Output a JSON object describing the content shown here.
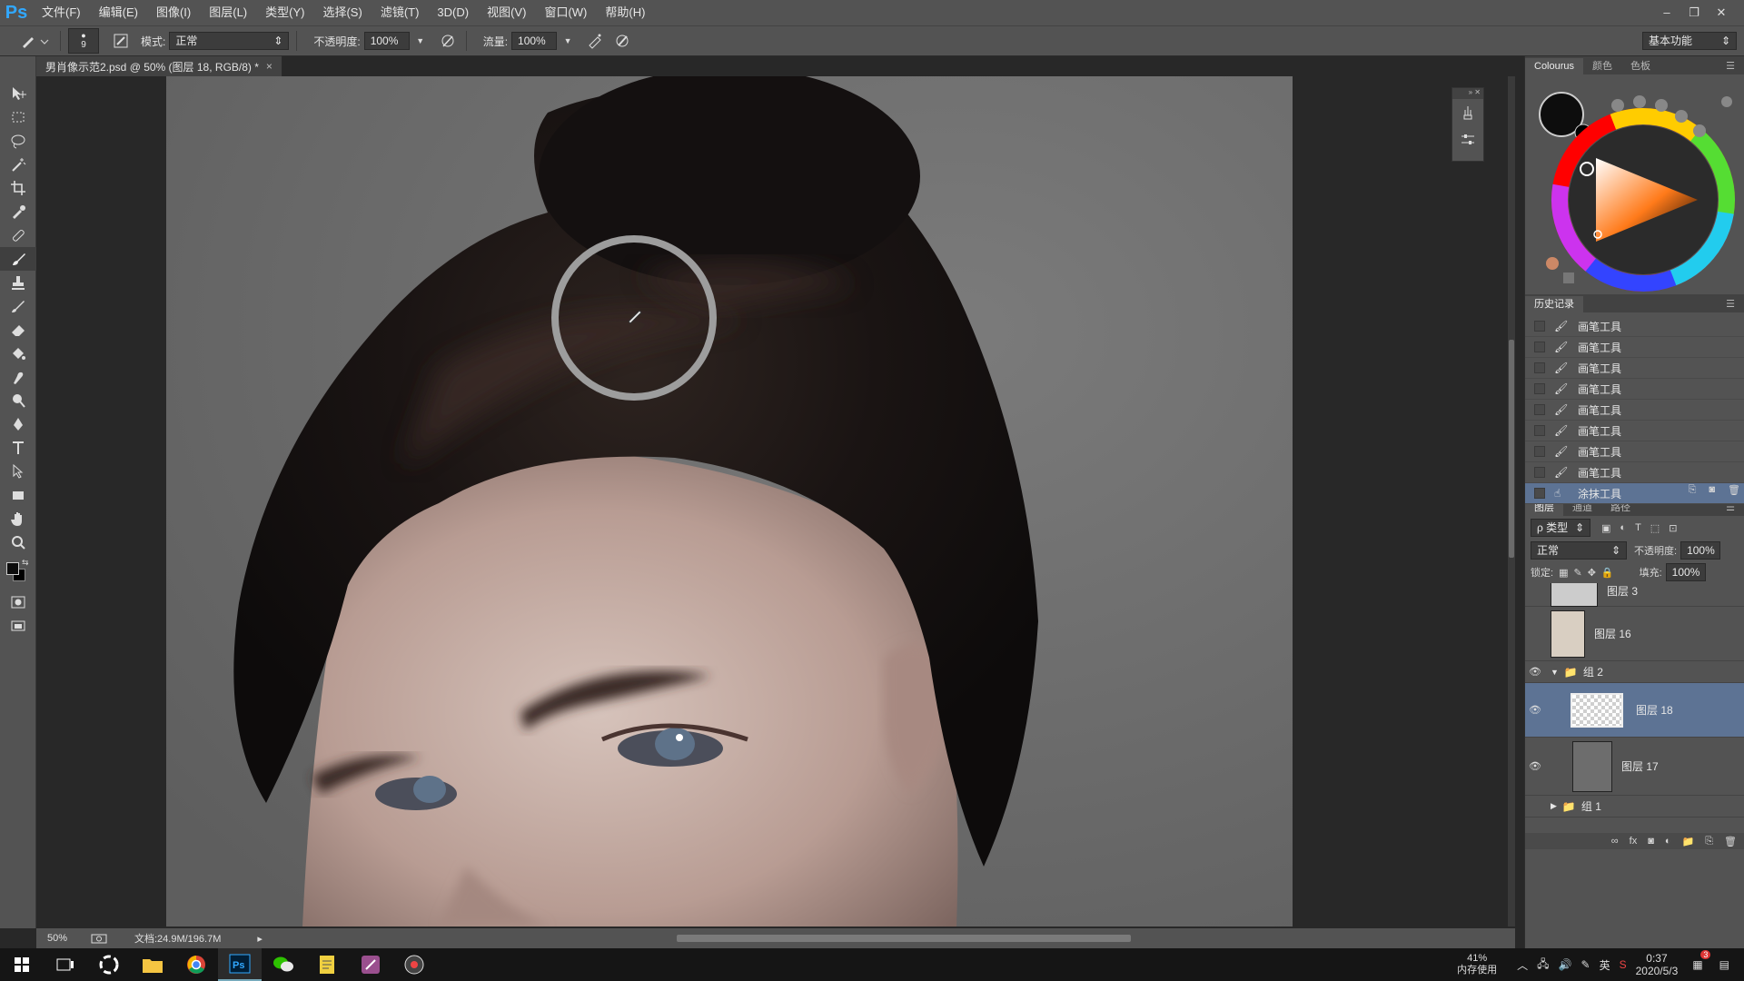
{
  "app": {
    "logo": "Ps"
  },
  "menu": [
    "文件(F)",
    "编辑(E)",
    "图像(I)",
    "图层(L)",
    "类型(Y)",
    "选择(S)",
    "滤镜(T)",
    "3D(D)",
    "视图(V)",
    "窗口(W)",
    "帮助(H)"
  ],
  "window_buttons": {
    "minimize": "–",
    "restore": "❐",
    "close": "✕"
  },
  "options": {
    "brush_size": "9",
    "mode_label": "模式:",
    "mode_value": "正常",
    "opacity_label": "不透明度:",
    "opacity_value": "100%",
    "flow_label": "流量:",
    "flow_value": "100%",
    "workspace": "基本功能"
  },
  "document": {
    "tab_title": "男肖像示范2.psd @ 50% (图层 18, RGB/8) *",
    "tab_close": "×",
    "zoom": "50%",
    "doc_info": "文档:24.9M/196.7M"
  },
  "color_panel": {
    "tabs": [
      "Colourus",
      "颜色",
      "色板"
    ],
    "active_tab": 0,
    "fg_color": "#0d0d0d",
    "bg_color": "#000000"
  },
  "history_panel": {
    "title": "历史记录",
    "items": [
      {
        "label": "画笔工具",
        "icon": "brush-icon",
        "selected": false
      },
      {
        "label": "画笔工具",
        "icon": "brush-icon",
        "selected": false
      },
      {
        "label": "画笔工具",
        "icon": "brush-icon",
        "selected": false
      },
      {
        "label": "画笔工具",
        "icon": "brush-icon",
        "selected": false
      },
      {
        "label": "画笔工具",
        "icon": "brush-icon",
        "selected": false
      },
      {
        "label": "画笔工具",
        "icon": "brush-icon",
        "selected": false
      },
      {
        "label": "画笔工具",
        "icon": "brush-icon",
        "selected": false
      },
      {
        "label": "画笔工具",
        "icon": "brush-icon",
        "selected": false
      },
      {
        "label": "涂抹工具",
        "icon": "smudge-icon",
        "selected": true
      }
    ]
  },
  "layers_panel": {
    "tabs": [
      "图层",
      "通道",
      "路径"
    ],
    "filter_label": "ρ 类型",
    "blend_mode": "正常",
    "opacity_label": "不透明度:",
    "opacity_value": "100%",
    "lock_label": "锁定:",
    "fill_label": "填充:",
    "fill_value": "100%",
    "layers": [
      {
        "name": "图层 3",
        "visible": false,
        "selected": false,
        "kind": "layer"
      },
      {
        "name": "图层 16",
        "visible": false,
        "selected": false,
        "kind": "layer"
      },
      {
        "name": "组 2",
        "visible": true,
        "selected": false,
        "kind": "group",
        "expanded": true
      },
      {
        "name": "图层 18",
        "visible": true,
        "selected": true,
        "kind": "layer"
      },
      {
        "name": "图层 17",
        "visible": true,
        "selected": false,
        "kind": "layer"
      },
      {
        "name": "组 1",
        "visible": false,
        "selected": false,
        "kind": "group",
        "expanded": false
      }
    ]
  },
  "taskbar": {
    "memory_percent": "41%",
    "memory_label": "内存使用",
    "ime": "英",
    "time": "0:37",
    "date": "2020/5/3",
    "notification_count": "3"
  }
}
